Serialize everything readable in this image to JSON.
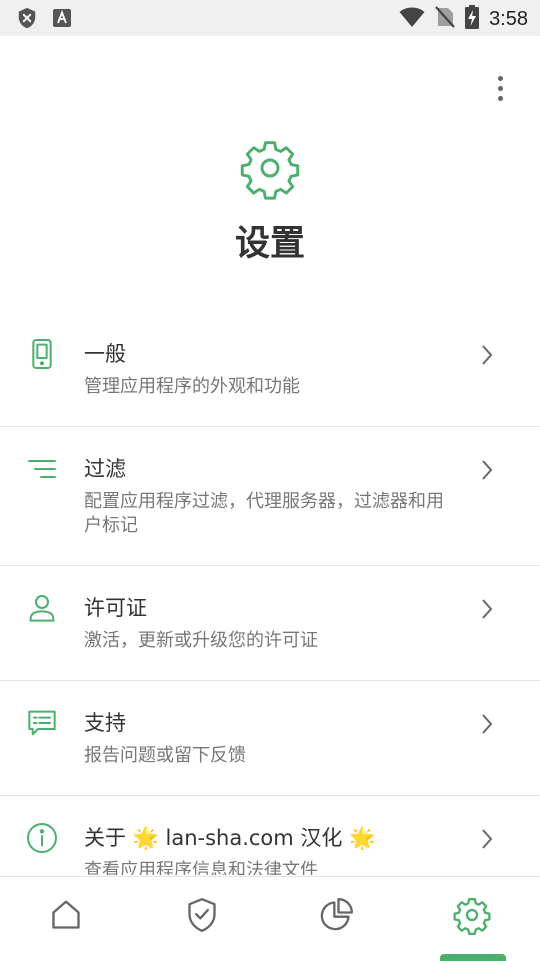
{
  "status_bar": {
    "time": "3:58",
    "left_icons": [
      "shield-x-icon",
      "font-a-icon"
    ],
    "right_icons": [
      "wifi-icon",
      "no-sim-icon",
      "battery-charging-icon"
    ]
  },
  "header": {
    "title": "设置",
    "icon": "gear-icon"
  },
  "menu": {
    "icon": "more-vertical-icon"
  },
  "settings": {
    "items": [
      {
        "label": "一般",
        "description": "管理应用程序的外观和功能",
        "icon": "phone-icon"
      },
      {
        "label": "过滤",
        "description": "配置应用程序过滤，代理服务器，过滤器和用户标记",
        "icon": "filter-lines-icon"
      },
      {
        "label": "许可证",
        "description": "激活，更新或升级您的许可证",
        "icon": "user-icon"
      },
      {
        "label": "支持",
        "description": "报告问题或留下反馈",
        "icon": "chat-icon"
      },
      {
        "label": "关于 🌟 lan-sha.com 汉化 🌟",
        "description": "查看应用程序信息和法律文件",
        "icon": "info-icon"
      }
    ]
  },
  "bottom_nav": {
    "items": [
      {
        "icon": "home-icon",
        "active": false
      },
      {
        "icon": "shield-check-icon",
        "active": false
      },
      {
        "icon": "pie-chart-icon",
        "active": false
      },
      {
        "icon": "gear-icon",
        "active": true
      }
    ]
  },
  "colors": {
    "accent": "#4caf6e",
    "background": "#ffffff",
    "status_bar": "#f0f0f0",
    "text_primary": "#333333",
    "text_secondary": "#777777"
  }
}
